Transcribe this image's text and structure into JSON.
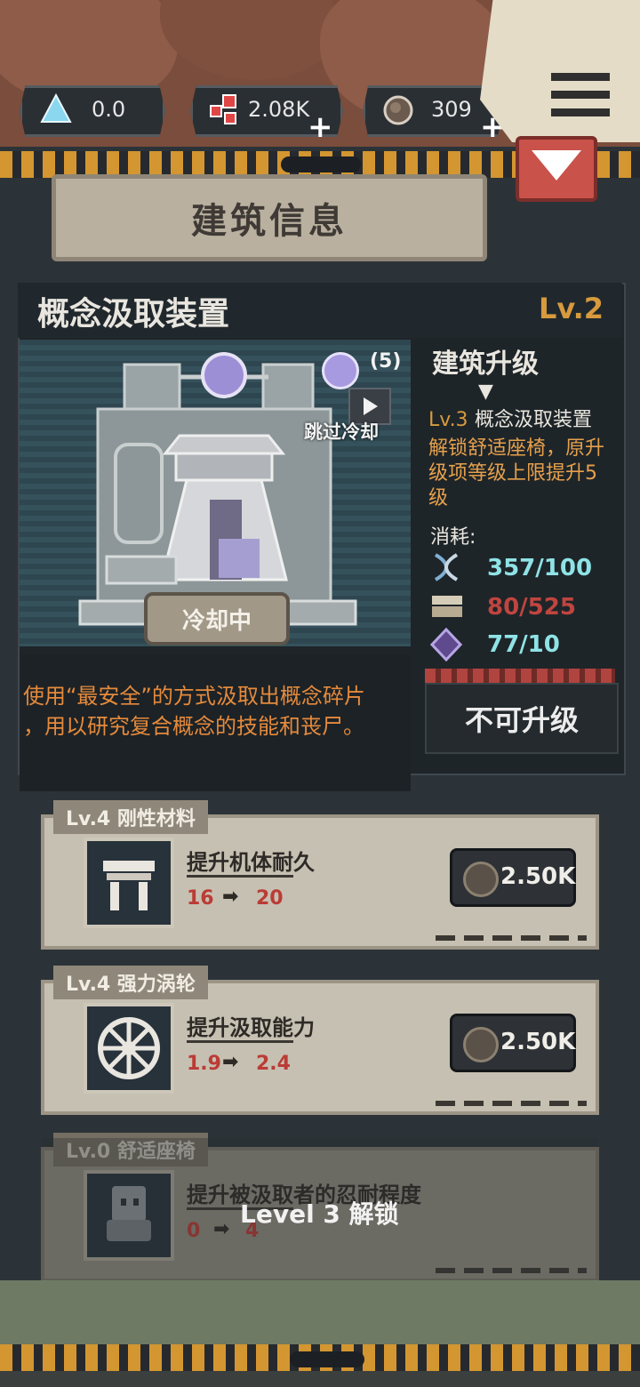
{
  "resources": [
    {
      "icon": "triangle-gem-icon",
      "value": "0.0",
      "has_plus": false
    },
    {
      "icon": "red-cubes-icon",
      "value": "2.08K",
      "has_plus": true
    },
    {
      "icon": "ore-coin-icon",
      "value": "309",
      "has_plus": true
    }
  ],
  "menu": {
    "icon": "hamburger-menu-icon"
  },
  "panel": {
    "title": "建筑信息",
    "close_icon": "chevron-down-icon"
  },
  "building": {
    "name": "概念汲取装置",
    "level": "Lv.2",
    "skip_count": "(5)",
    "skip_label": "跳过冷却",
    "cooldown_label": "冷却中",
    "description_lines": [
      "使用“最安全”的方式汲取出概念碎片",
      "，用以研究复合概念的技能和丧尸。"
    ]
  },
  "upgrade": {
    "title": "建筑升级",
    "next_level": "Lv.3",
    "next_name": "概念汲取装置",
    "unlock_lines": [
      "解锁舒适座椅，原升",
      "级项等级上限提升5",
      "级"
    ],
    "cost_label": "消耗:",
    "costs": [
      {
        "icon": "dna-icon",
        "value": "357/100",
        "color": "#8fe3e6"
      },
      {
        "icon": "cloth-bundle-icon",
        "value": "80/525",
        "color": "#c0453f"
      },
      {
        "icon": "purple-crystal-icon",
        "value": "77/10",
        "color": "#8fe3e6"
      }
    ],
    "button_label": "不可升级"
  },
  "items": [
    {
      "tag": "Lv.4 刚性材料",
      "name": "提升机体耐久",
      "from": "16",
      "to": "20",
      "price": "2.50K",
      "icon": "table-icon",
      "locked": false
    },
    {
      "tag": "Lv.4 强力涡轮",
      "name": "提升汲取能力",
      "from": "1.9",
      "to": "2.4",
      "price": "2.50K",
      "icon": "turbine-icon",
      "locked": false
    },
    {
      "tag": "Lv.0 舒适座椅",
      "name": "提升被汲取者的忍耐程度",
      "from": "0",
      "to": "4",
      "icon": "chair-icon",
      "locked": true,
      "lock_text": "Level 3 解锁"
    }
  ],
  "arrow_glyph": "➡"
}
